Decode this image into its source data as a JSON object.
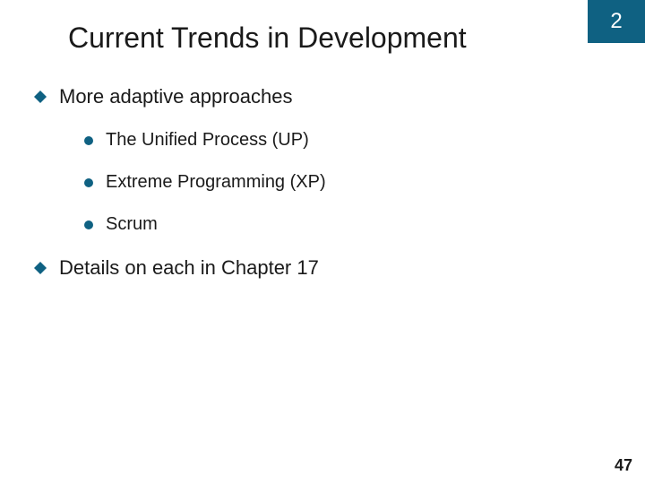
{
  "corner_number": "2",
  "title": "Current Trends in Development",
  "bullets": {
    "item1": {
      "text": "More adaptive approaches",
      "sub1": "The Unified Process (UP)",
      "sub2": "Extreme Programming (XP)",
      "sub3": "Scrum"
    },
    "item2": {
      "text": "Details on each in Chapter 17"
    }
  },
  "page_number": "47",
  "accent_color": "#0f6182"
}
